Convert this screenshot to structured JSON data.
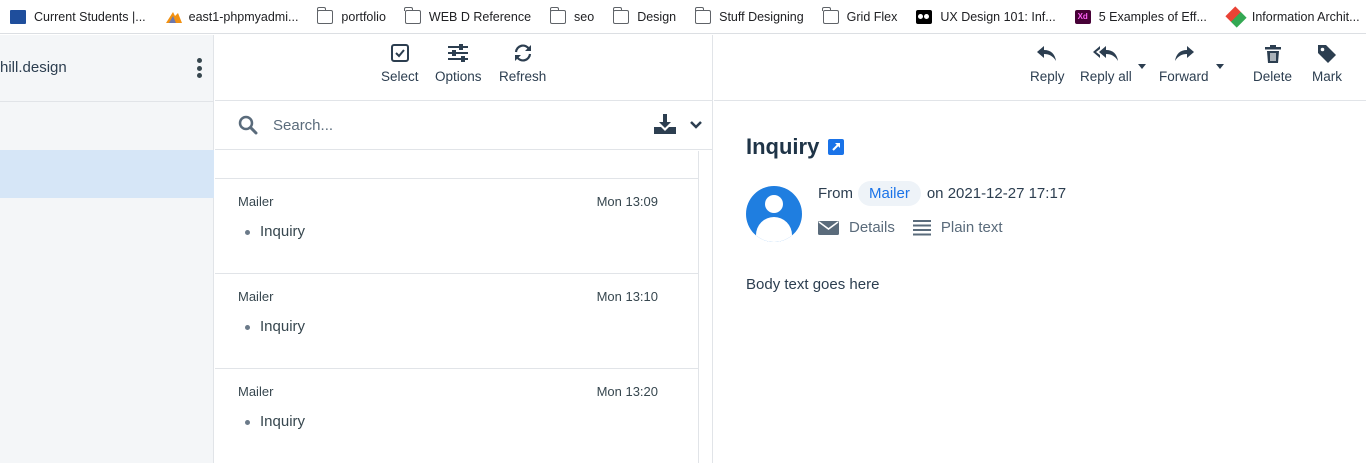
{
  "bookmarks": [
    {
      "label": "Current Students |...",
      "icon": "site-icon"
    },
    {
      "label": "east1-phpmyadmi...",
      "icon": "phpmyadmin-icon"
    },
    {
      "label": "portfolio",
      "icon": "folder-icon"
    },
    {
      "label": "WEB D Reference",
      "icon": "folder-icon"
    },
    {
      "label": "seo",
      "icon": "folder-icon"
    },
    {
      "label": "Design",
      "icon": "folder-icon"
    },
    {
      "label": "Stuff Designing",
      "icon": "folder-icon"
    },
    {
      "label": "Grid Flex",
      "icon": "folder-icon"
    },
    {
      "label": "UX Design 101: Inf...",
      "icon": "medium-icon"
    },
    {
      "label": "5 Examples of Eff...",
      "icon": "xd-icon"
    },
    {
      "label": "Information Archit...",
      "icon": "diamond-icon"
    }
  ],
  "sidebar": {
    "domain": "hill.design"
  },
  "list_toolbar": {
    "select_label": "Select",
    "options_label": "Options",
    "refresh_label": "Refresh"
  },
  "search": {
    "placeholder": "Search..."
  },
  "messages": [
    {
      "from": "Mailer",
      "time": "Mon 13:09",
      "subject": "Inquiry"
    },
    {
      "from": "Mailer",
      "time": "Mon 13:10",
      "subject": "Inquiry"
    },
    {
      "from": "Mailer",
      "time": "Mon 13:20",
      "subject": "Inquiry"
    }
  ],
  "reader_toolbar": {
    "reply_label": "Reply",
    "reply_all_label": "Reply all",
    "forward_label": "Forward",
    "delete_label": "Delete",
    "mark_label": "Mark"
  },
  "email": {
    "subject": "Inquiry",
    "from_prefix": "From",
    "sender": "Mailer",
    "date_text": "on 2021-12-27 17:17",
    "details_label": "Details",
    "plain_text_label": "Plain text",
    "body": "Body text goes here"
  },
  "colors": {
    "accent": "#1a73e8",
    "selected_row": "#d6e6f7",
    "avatar": "#1f7ee0",
    "text_dark": "#2c3e50"
  }
}
